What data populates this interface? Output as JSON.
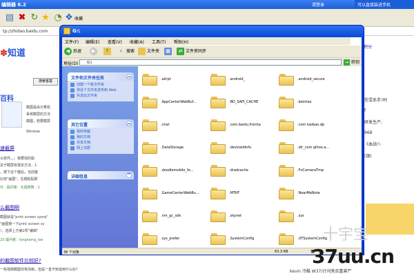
{
  "browser": {
    "title_fragment": "编辑器 6.2",
    "right_title": "请登录",
    "corner_note": "可以直接装进手机",
    "address_fragment": "tp://zhidao.baidu.com",
    "toolbar_label": "收藏"
  },
  "background_page": {
    "logo_text": "知道",
    "search_button": "搜索答案",
    "baike_text": "百科",
    "snippets": [
      "截图是由计算机",
      "系统截屏的方法",
      "截图，若要截屏",
      "Window"
    ],
    "headline1": "速截屏",
    "para1": [
      "么软件。。。我要找的能",
      "关于截屏有很多方法，1",
      "，按下这个键后，当前整",
      "比较\"画图\"，右键粘贴即"
    ],
    "meta1": "日 · 提问者：北极熊熊 · 1",
    "headline2": "么截图啊",
    "para2": [
      "截图就是\"print screen sysrq\"",
      "\"画图按一下print screen sy",
      "），选择上方第2项\"编辑\"",
      "23 提问者：kingloong_lee"
    ],
    "headline3": "的截图软件比较好?",
    "para3": "一些视频截图非常清晰，但是一直不知道用什么好?",
    "right_tabs": "积分",
    "right_col": [
      "型混系手?村",
      "f",
      "研发生产,",
      "968",
      "",
      "《血战八",
      "(银)"
    ],
    "bottom_right": "kevin 冷酷 W37/计刈夹且重曾尸"
  },
  "explorer": {
    "title": "G:\\",
    "menu": [
      "文件(F)",
      "编辑(E)",
      "查看(V)",
      "收藏(A)",
      "工具(T)",
      "帮助(H)"
    ],
    "tools": {
      "back": "后退",
      "search": "搜索",
      "folders": "文件夹",
      "sync": "文件夹同步"
    },
    "address_label": "地址(D)",
    "address_value": "G:\\",
    "go_label": "转到",
    "panels": {
      "tasks": {
        "title": "文件和文件夹任务",
        "items": [
          "创建一个新文件夹",
          "将这个文件夹发布到 Web",
          "共享此文件夹"
        ]
      },
      "places": {
        "title": "其它位置",
        "items": [
          "我的电脑",
          "我的文档",
          "共享文档",
          "网上邻居"
        ]
      },
      "details": {
        "title": "详细信息"
      }
    },
    "folders": [
      ".alirpt",
      ".android_",
      ".android_secure",
      ".AppCenterWebBuf...",
      ".BD_SAPI_CACHE",
      ".beintoo",
      ".chat",
      ".com.baidu.frontia",
      ".com.taobao.dp",
      ".DataStorage",
      ".deviceidInfo",
      ".dir_com.qihoo.a...",
      ".doodlemobile_fe...",
      ".dradcache",
      ".FxCameraTmp",
      ".GameCenterWebBu...",
      ".MTKF",
      ".NearMeNote",
      ".nm_gc_sdk",
      ".skynet",
      ".sys",
      ".sys_prefer",
      ".SystemConfig",
      ".UTSystemConfig"
    ],
    "status_left": "36 个对象",
    "status_size": "63.3 KB"
  },
  "watermark": "37uu.cn",
  "watermark_faint": "十宇宝"
}
